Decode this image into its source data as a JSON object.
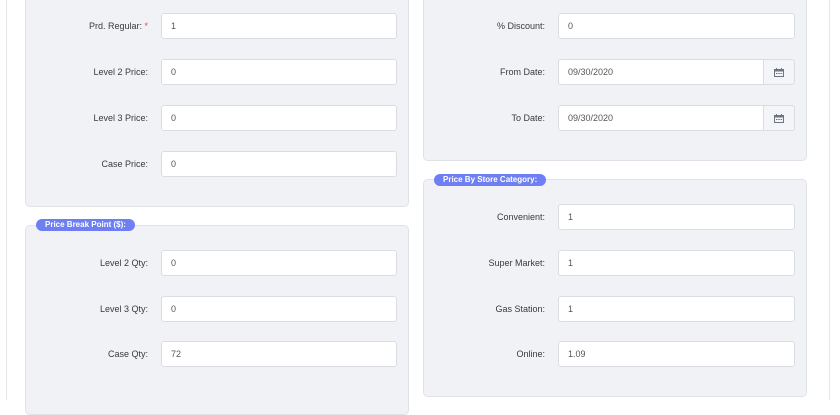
{
  "regular_pricing": {
    "prd_regular": {
      "label": "Prd. Regular:",
      "required_mark": "*",
      "value": "1"
    },
    "level2_price": {
      "label": "Level 2 Price:",
      "value": "0"
    },
    "level3_price": {
      "label": "Level 3 Price:",
      "value": "0"
    },
    "case_price": {
      "label": "Case Price:",
      "value": "0"
    }
  },
  "discount": {
    "percent_discount": {
      "label": "% Discount:",
      "value": "0"
    },
    "from_date": {
      "label": "From Date:",
      "value": "09/30/2020"
    },
    "to_date": {
      "label": "To Date:",
      "value": "09/30/2020"
    }
  },
  "price_break_point": {
    "title": "Price Break Point ($):",
    "level2_qty": {
      "label": "Level 2 Qty:",
      "value": "0"
    },
    "level3_qty": {
      "label": "Level 3 Qty:",
      "value": "0"
    },
    "case_qty": {
      "label": "Case Qty:",
      "value": "72"
    }
  },
  "price_by_store_category": {
    "title": "Price By Store Category:",
    "convenient": {
      "label": "Convenient:",
      "value": "1"
    },
    "super_market": {
      "label": "Super Market:",
      "value": "1"
    },
    "gas_station": {
      "label": "Gas Station:",
      "value": "1"
    },
    "online": {
      "label": "Online:",
      "value": "1.09"
    }
  },
  "icons": {
    "date_picker": "calendar-icon"
  },
  "colors": {
    "legend_badge": "#6e7ff3",
    "panel_background": "#f1f2f6",
    "required_star": "#e04b4b"
  }
}
